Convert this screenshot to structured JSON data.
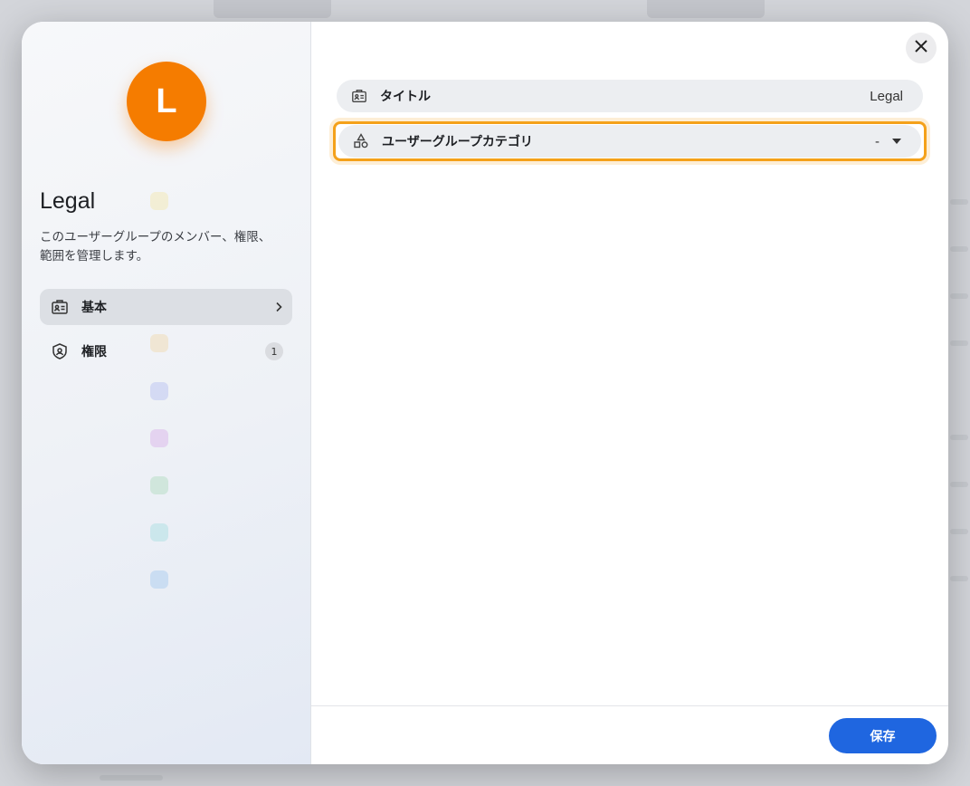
{
  "group": {
    "avatar_letter": "L",
    "avatar_color": "#f57c00",
    "title": "Legal",
    "description": "このユーザーグループのメンバー、権限、範囲を管理します。"
  },
  "nav": {
    "items": [
      {
        "label": "基本",
        "icon": "id-card-icon",
        "active": true
      },
      {
        "label": "権限",
        "icon": "shield-icon",
        "badge": "1"
      }
    ]
  },
  "fields": {
    "title": {
      "label": "タイトル",
      "value": "Legal",
      "icon": "id-card-icon"
    },
    "category": {
      "label": "ユーザーグループカテゴリ",
      "value": "-",
      "icon": "shapes-icon"
    }
  },
  "footer": {
    "save_label": "保存"
  },
  "colors": {
    "accent": "#1f66e0",
    "focus": "#f4a11a"
  }
}
